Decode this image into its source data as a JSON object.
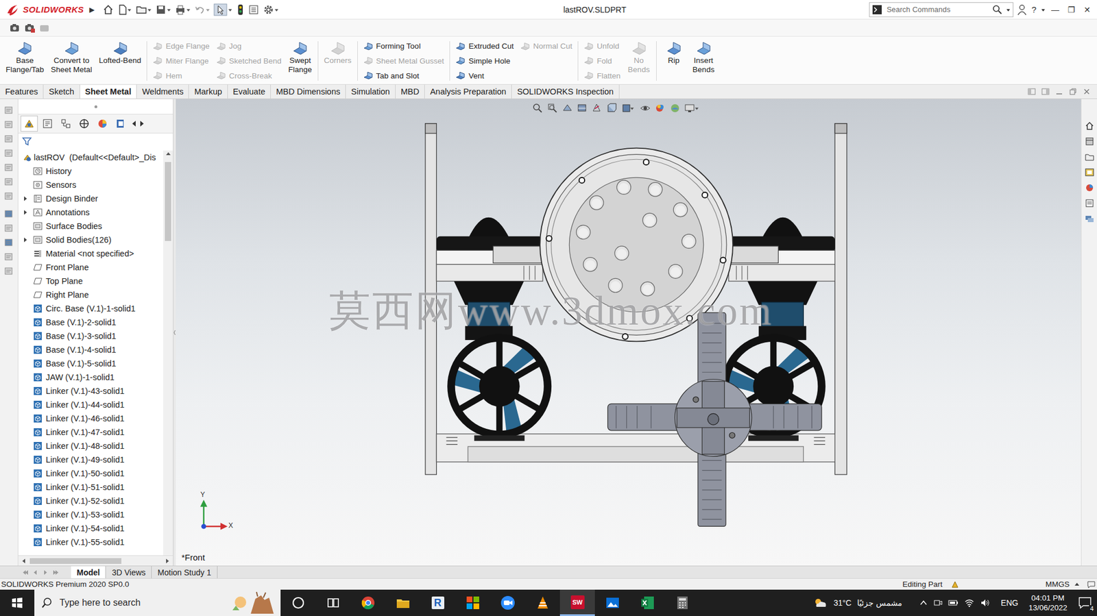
{
  "app": {
    "logo_text": "SOLIDWORKS",
    "menu_arrow": "▶"
  },
  "window": {
    "title": "lastROV.SLDPRT",
    "controls": [
      "—",
      "❐",
      "✕"
    ]
  },
  "search": {
    "placeholder": "Search Commands"
  },
  "help": {
    "label": "?"
  },
  "ribbon": [
    {
      "kind": "large",
      "lines": [
        "Base",
        "Flange/Tab"
      ],
      "disabled": false
    },
    {
      "kind": "large",
      "lines": [
        "Convert to",
        "Sheet Metal"
      ],
      "disabled": false
    },
    {
      "kind": "large",
      "lines": [
        "Lofted-Bend"
      ],
      "disabled": false
    },
    {
      "kind": "separator"
    },
    {
      "kind": "stack",
      "items": [
        {
          "label": "Edge Flange",
          "disabled": true
        },
        {
          "label": "Miter Flange",
          "disabled": true
        },
        {
          "label": "Hem",
          "disabled": true
        }
      ]
    },
    {
      "kind": "stack",
      "items": [
        {
          "label": "Jog",
          "disabled": true
        },
        {
          "label": "Sketched Bend",
          "disabled": true
        },
        {
          "label": "Cross-Break",
          "disabled": true
        }
      ]
    },
    {
      "kind": "large",
      "lines": [
        "Swept",
        "Flange"
      ],
      "disabled": false
    },
    {
      "kind": "separator"
    },
    {
      "kind": "large",
      "lines": [
        "Corners"
      ],
      "disabled": true
    },
    {
      "kind": "separator"
    },
    {
      "kind": "stack",
      "items": [
        {
          "label": "Forming Tool",
          "disabled": false
        },
        {
          "label": "Sheet Metal Gusset",
          "disabled": true
        },
        {
          "label": "Tab and Slot",
          "disabled": false
        }
      ]
    },
    {
      "kind": "separator"
    },
    {
      "kind": "stack",
      "items": [
        {
          "label": "Extruded Cut",
          "disabled": false
        },
        {
          "label": "Simple Hole",
          "disabled": false
        },
        {
          "label": "Vent",
          "disabled": false
        }
      ]
    },
    {
      "kind": "stack",
      "items": [
        {
          "label": "Normal Cut",
          "disabled": true
        }
      ]
    },
    {
      "kind": "separator"
    },
    {
      "kind": "stack",
      "items": [
        {
          "label": "Unfold",
          "disabled": true
        },
        {
          "label": "Fold",
          "disabled": true
        },
        {
          "label": "Flatten",
          "disabled": true
        }
      ]
    },
    {
      "kind": "large",
      "lines": [
        "No",
        "Bends"
      ],
      "disabled": true
    },
    {
      "kind": "separator"
    },
    {
      "kind": "large",
      "lines": [
        "Rip"
      ],
      "disabled": false
    },
    {
      "kind": "large",
      "lines": [
        "Insert",
        "Bends"
      ],
      "disabled": false
    }
  ],
  "tabs": [
    {
      "label": "Features",
      "selected": false
    },
    {
      "label": "Sketch",
      "selected": false
    },
    {
      "label": "Sheet Metal",
      "selected": true
    },
    {
      "label": "Weldments",
      "selected": false
    },
    {
      "label": "Markup",
      "selected": false
    },
    {
      "label": "Evaluate",
      "selected": false
    },
    {
      "label": "MBD Dimensions",
      "selected": false
    },
    {
      "label": "Simulation",
      "selected": false
    },
    {
      "label": "MBD",
      "selected": false
    },
    {
      "label": "Analysis Preparation",
      "selected": false
    },
    {
      "label": "SOLIDWORKS Inspection",
      "selected": false
    }
  ],
  "panel_tabs": [
    {
      "selected": true
    },
    {
      "selected": false
    },
    {
      "selected": false
    },
    {
      "selected": false
    },
    {
      "selected": false
    },
    {
      "selected": false
    }
  ],
  "tree": {
    "root": "lastROV  (Default<<Default>_Dis",
    "items": [
      {
        "label": "History",
        "kind": "history",
        "has_arrow": false
      },
      {
        "label": "Sensors",
        "kind": "sensors",
        "has_arrow": false
      },
      {
        "label": "Design Binder",
        "kind": "binder",
        "has_arrow": true
      },
      {
        "label": "Annotations",
        "kind": "annotations",
        "has_arrow": true
      },
      {
        "label": "Surface Bodies",
        "kind": "folder",
        "has_arrow": false
      },
      {
        "label": "Solid Bodies(126)",
        "kind": "folder",
        "has_arrow": true
      },
      {
        "label": "Material <not specified>",
        "kind": "material",
        "has_arrow": false
      },
      {
        "label": "Front Plane",
        "kind": "plane",
        "has_arrow": false
      },
      {
        "label": "Top Plane",
        "kind": "plane",
        "has_arrow": false
      },
      {
        "label": "Right Plane",
        "kind": "plane",
        "has_arrow": false
      },
      {
        "label": "Circ. Base (V.1)-1-solid1",
        "kind": "body",
        "has_arrow": false
      },
      {
        "label": "Base (V.1)-2-solid1",
        "kind": "body",
        "has_arrow": false
      },
      {
        "label": "Base (V.1)-3-solid1",
        "kind": "body",
        "has_arrow": false
      },
      {
        "label": "Base (V.1)-4-solid1",
        "kind": "body",
        "has_arrow": false
      },
      {
        "label": "Base (V.1)-5-solid1",
        "kind": "body",
        "has_arrow": false
      },
      {
        "label": "JAW (V.1)-1-solid1",
        "kind": "body",
        "has_arrow": false
      },
      {
        "label": "Linker (V.1)-43-solid1",
        "kind": "body",
        "has_arrow": false
      },
      {
        "label": "Linker (V.1)-44-solid1",
        "kind": "body",
        "has_arrow": false
      },
      {
        "label": "Linker (V.1)-46-solid1",
        "kind": "body",
        "has_arrow": false
      },
      {
        "label": "Linker (V.1)-47-solid1",
        "kind": "body",
        "has_arrow": false
      },
      {
        "label": "Linker (V.1)-48-solid1",
        "kind": "body",
        "has_arrow": false
      },
      {
        "label": "Linker (V.1)-49-solid1",
        "kind": "body",
        "has_arrow": false
      },
      {
        "label": "Linker (V.1)-50-solid1",
        "kind": "body",
        "has_arrow": false
      },
      {
        "label": "Linker (V.1)-51-solid1",
        "kind": "body",
        "has_arrow": false
      },
      {
        "label": "Linker (V.1)-52-solid1",
        "kind": "body",
        "has_arrow": false
      },
      {
        "label": "Linker (V.1)-53-solid1",
        "kind": "body",
        "has_arrow": false
      },
      {
        "label": "Linker (V.1)-54-solid1",
        "kind": "body",
        "has_arrow": false
      },
      {
        "label": "Linker (V.1)-55-solid1",
        "kind": "body",
        "has_arrow": false
      }
    ]
  },
  "viewport": {
    "view_label": "*Front",
    "watermark": "莫西网www.3dmox.com",
    "axis_x": "X",
    "axis_y": "Y"
  },
  "bottom_tabs": [
    {
      "label": "Model",
      "selected": true
    },
    {
      "label": "3D Views",
      "selected": false
    },
    {
      "label": "Motion Study 1",
      "selected": false
    }
  ],
  "status_bar": {
    "product": "SOLIDWORKS Premium 2020 SP0.0",
    "mode": "Editing Part",
    "units": "MMGS"
  },
  "taskbar": {
    "search_placeholder": "Type here to search",
    "apps": [
      {
        "kind": "cortana",
        "active": false
      },
      {
        "kind": "taskview",
        "active": false
      },
      {
        "kind": "chrome",
        "active": false
      },
      {
        "kind": "explorer",
        "active": false
      },
      {
        "kind": "rapp",
        "active": false,
        "glyph": "R"
      },
      {
        "kind": "office",
        "active": false
      },
      {
        "kind": "zoom",
        "active": false
      },
      {
        "kind": "vlc",
        "active": false
      },
      {
        "kind": "solidworks",
        "active": true,
        "glyph": "SW"
      },
      {
        "kind": "photos",
        "active": false
      },
      {
        "kind": "excel",
        "active": false
      },
      {
        "kind": "calculator",
        "active": false
      }
    ],
    "temperature": "31°C",
    "weather": "مشمس جزئيًا",
    "language": "ENG",
    "time": "04:01 PM",
    "date": "13/06/2022",
    "notifications": "4"
  }
}
